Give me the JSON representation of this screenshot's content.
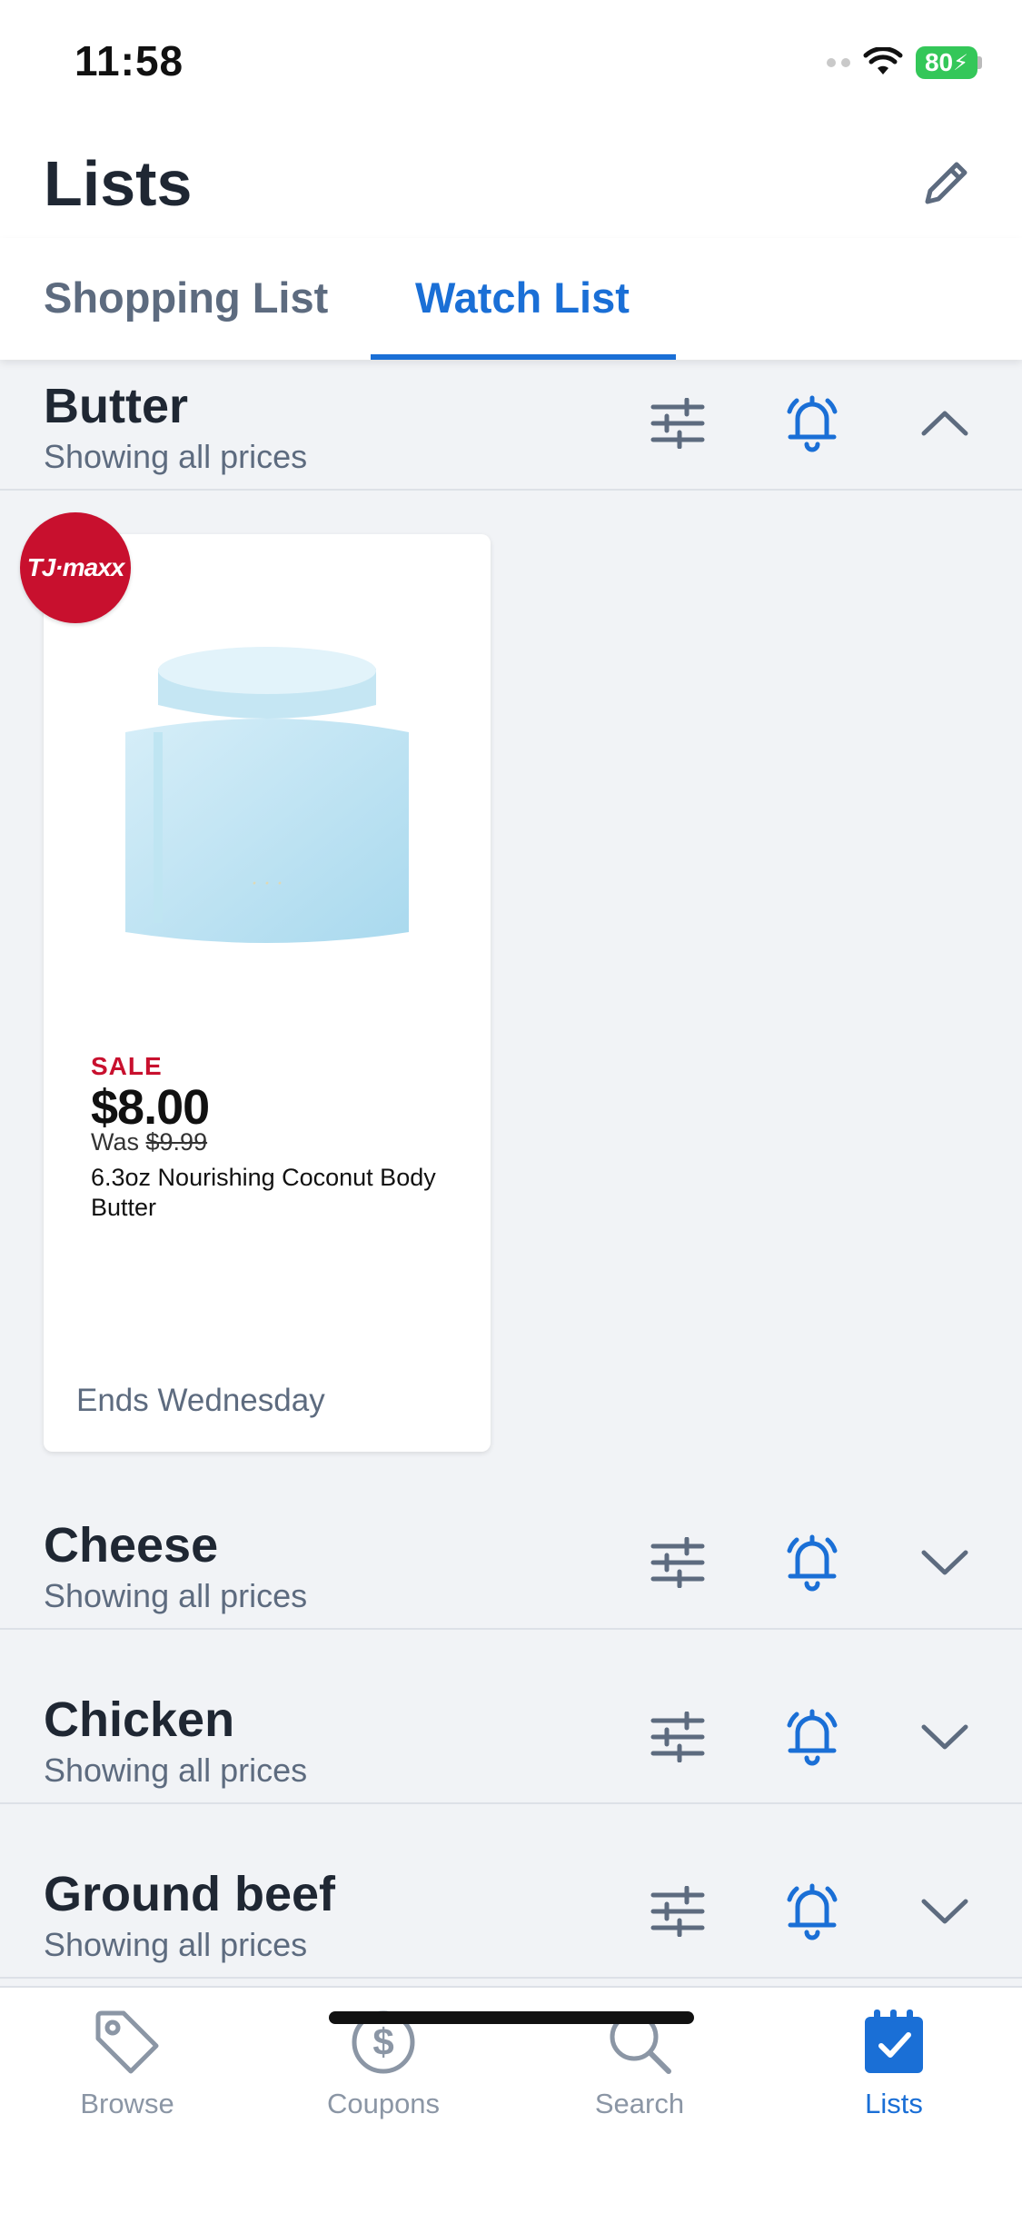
{
  "status_bar": {
    "time": "11:58",
    "battery": "80"
  },
  "header": {
    "title": "Lists"
  },
  "tabs": [
    {
      "label": "Shopping List",
      "active": false
    },
    {
      "label": "Watch List",
      "active": true
    }
  ],
  "sections": [
    {
      "title": "Butter",
      "subtitle": "Showing all prices",
      "expanded": true
    },
    {
      "title": "Cheese",
      "subtitle": "Showing all prices",
      "expanded": false
    },
    {
      "title": "Chicken",
      "subtitle": "Showing all prices",
      "expanded": false
    },
    {
      "title": "Ground beef",
      "subtitle": "Showing all prices",
      "expanded": false
    }
  ],
  "product": {
    "store_logo": "TJ·maxx",
    "sale_label": "SALE",
    "price": "$8.00",
    "was_prefix": "Was",
    "was_price": "$9.99",
    "name": "6.3oz Nourishing Coconut Body Butter",
    "ends": "Ends Wednesday"
  },
  "icons": {
    "edit": "pencil-icon",
    "filter": "sliders-icon",
    "alert": "bell-icon",
    "expand": "chevron-icon"
  },
  "colors": {
    "accent": "#1a6fd6",
    "sale": "#c8102e",
    "battery": "#34c759"
  },
  "tabbar": [
    {
      "label": "Browse",
      "icon": "tag-icon",
      "active": false
    },
    {
      "label": "Coupons",
      "icon": "dollar-coin-icon",
      "active": false
    },
    {
      "label": "Search",
      "icon": "search-icon",
      "active": false
    },
    {
      "label": "Lists",
      "icon": "calendar-check-icon",
      "active": true
    }
  ]
}
